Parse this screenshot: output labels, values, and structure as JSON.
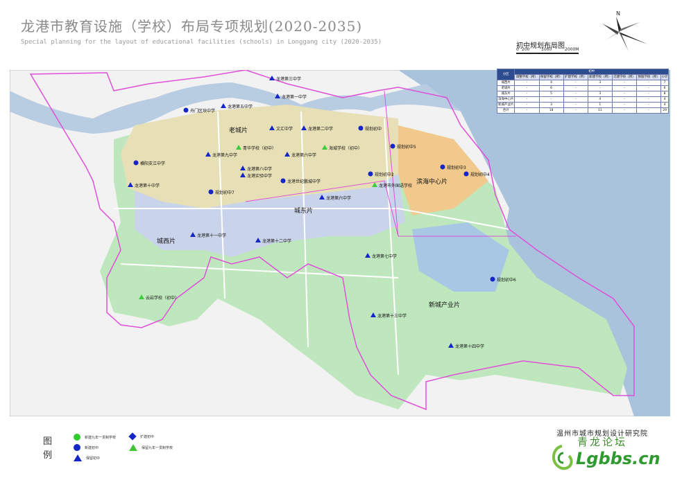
{
  "title_cn": "龙港市教育设施（学校）布局专项规划(2020-2035)",
  "title_en": "Special planning for the layout of educational facilities (schools) in Longgang city (2020-2035)",
  "map_title": "初中规划布局图",
  "scale": {
    "labels": [
      "0",
      "200",
      "1000",
      "2000M"
    ]
  },
  "table": {
    "group_header": "初中",
    "columns": [
      "分区",
      "调整学校（所）",
      "保留学校（所）",
      "扩建学校（所）",
      "新建学校（所）",
      "迁建学校（所）",
      "预留学校（所）",
      "小计"
    ],
    "rows": [
      [
        "城西片",
        "-",
        "4",
        "-",
        "3",
        "-",
        "-",
        "7"
      ],
      [
        "老城片",
        "-",
        "6",
        "-",
        "-",
        "-",
        "-",
        "6"
      ],
      [
        "城东片",
        "-",
        "5",
        "-",
        "3",
        "-",
        "-",
        "8"
      ],
      [
        "滨海中心片",
        "-",
        "-",
        "-",
        "4",
        "-",
        "-",
        "4"
      ],
      [
        "新城产业片",
        "-",
        "3",
        "-",
        "1",
        "-",
        "-",
        "4"
      ],
      [
        "合计",
        "-",
        "18",
        "-",
        "11",
        "-",
        "-",
        "29"
      ]
    ]
  },
  "districts": {
    "laocheng": "老城片",
    "chengdong": "城东片",
    "chengxi": "城西片",
    "binhai": "滨海中心片",
    "xincheng": "新城产业片"
  },
  "schools": [
    {
      "label": "龙港第三中学",
      "type": "keep"
    },
    {
      "label": "龙港第一中学",
      "type": "keep"
    },
    {
      "label": "舟门区块中学",
      "type": "new"
    },
    {
      "label": "龙港第五中学",
      "type": "keep"
    },
    {
      "label": "文汇中学",
      "type": "keep"
    },
    {
      "label": "龙港第二中学",
      "type": "keep"
    },
    {
      "label": "规划初中",
      "type": "new"
    },
    {
      "label": "青华学校（初中）",
      "type": "rebuild9"
    },
    {
      "label": "龙港第九中学",
      "type": "keep"
    },
    {
      "label": "龙港第六中学",
      "type": "keep"
    },
    {
      "label": "海城学校（初中）",
      "type": "rebuild9"
    },
    {
      "label": "规划初中5",
      "type": "new"
    },
    {
      "label": "龙港第八中学",
      "type": "keep"
    },
    {
      "label": "规划初中3",
      "type": "new"
    },
    {
      "label": "规划初中4",
      "type": "new"
    },
    {
      "label": "横阳支江中学",
      "type": "new"
    },
    {
      "label": "龙港实验中学",
      "type": "keep"
    },
    {
      "label": "规划初中2",
      "type": "new"
    },
    {
      "label": "龙港世纪鹏城中学",
      "type": "new"
    },
    {
      "label": "龙港市外国语学校",
      "type": "rebuild9"
    },
    {
      "label": "龙港第十中学",
      "type": "keep"
    },
    {
      "label": "规划初中7",
      "type": "new"
    },
    {
      "label": "龙港第六中学",
      "type": "keep"
    },
    {
      "label": "龙港第十一中学",
      "type": "keep"
    },
    {
      "label": "龙港第十二中学",
      "type": "keep"
    },
    {
      "label": "龙港第七中学",
      "type": "keep"
    },
    {
      "label": "规划初中6",
      "type": "new"
    },
    {
      "label": "云岩学校（初中）",
      "type": "rebuild9"
    },
    {
      "label": "龙港第十三中学",
      "type": "keep"
    },
    {
      "label": "龙港第十四中学",
      "type": "keep"
    }
  ],
  "legend": {
    "title": "图例",
    "items": [
      {
        "label": "新建九年一贯制学校",
        "symbol": "green-circle"
      },
      {
        "label": "扩建初中",
        "symbol": "blue-diamond"
      },
      {
        "label": "新建初中",
        "symbol": "blue-circle"
      },
      {
        "label": "保留初中",
        "symbol": "blue-triangle"
      },
      {
        "label": "保留九年一贯制学校",
        "symbol": "green-triangle"
      }
    ]
  },
  "institute": "温州市城市规划设计研究院",
  "watermark": {
    "cn": "青龙论坛",
    "en": "Lgbbs.cn"
  },
  "colors": {
    "boundary": "#e04fd9",
    "sea": "#a9c3dc",
    "green_area": "#bfe7bd",
    "urban_blue": "#c9d3ea",
    "school_blue": "#1426c8",
    "school_green": "#3ecb3e"
  }
}
